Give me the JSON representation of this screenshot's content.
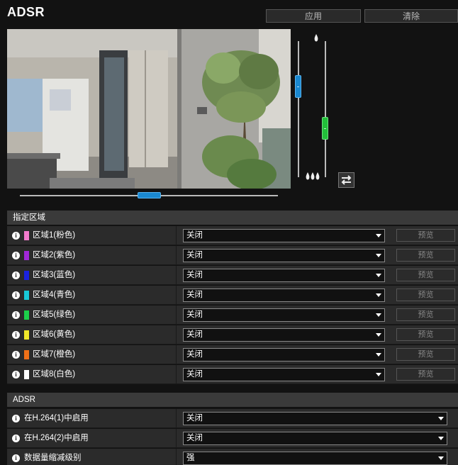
{
  "header": {
    "title": "ADSR",
    "apply_label": "应用",
    "clear_label": "清除"
  },
  "sliders": {
    "vertical_top_icon": "single-flame-icon",
    "vertical_bottom_icon": "triple-flame-icon",
    "swap_icon": "swap-arrows-icon",
    "colors": {
      "blue": "#1a88d0",
      "green": "#22c03a"
    }
  },
  "zone_section": {
    "title": "指定区域",
    "preview_label": "预览",
    "zones": [
      {
        "label": "区域1(粉色)",
        "color": "#f37bcc",
        "value": "关闭"
      },
      {
        "label": "区域2(紫色)",
        "color": "#a128d8",
        "value": "关闭"
      },
      {
        "label": "区域3(蓝色)",
        "color": "#1a22e0",
        "value": "关闭"
      },
      {
        "label": "区域4(青色)",
        "color": "#18c9d8",
        "value": "关闭"
      },
      {
        "label": "区域5(绿色)",
        "color": "#1cd04a",
        "value": "关闭"
      },
      {
        "label": "区域6(黄色)",
        "color": "#f0e82a",
        "value": "关闭"
      },
      {
        "label": "区域7(橙色)",
        "color": "#f07018",
        "value": "关闭"
      },
      {
        "label": "区域8(白色)",
        "color": "#ffffff",
        "value": "关闭"
      }
    ]
  },
  "adsr_section": {
    "title": "ADSR",
    "rows": [
      {
        "label": "在H.264(1)中启用",
        "value": "关闭"
      },
      {
        "label": "在H.264(2)中启用",
        "value": "关闭"
      },
      {
        "label": "数据量缩减级别",
        "value": "强"
      }
    ]
  }
}
